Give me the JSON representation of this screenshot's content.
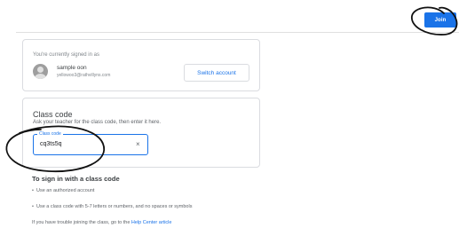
{
  "header": {
    "join_label": "Join"
  },
  "account": {
    "signed_in_text": "You're currently signed in as",
    "name": "sample oon",
    "email": "yellowoo3@rathvillyns.com",
    "switch_label": "Switch account"
  },
  "class_code": {
    "title": "Class code",
    "help": "Ask your teacher for the class code, then enter it here.",
    "field_label": "Class code",
    "value": "cq3ts5q",
    "clear_icon": "×"
  },
  "instructions": {
    "title": "To sign in with a class code",
    "items": [
      "Use an authorized account",
      "Use a class code with 5-7 letters or numbers, and no spaces or symbols"
    ],
    "trouble_text": "If you have trouble joining the class, go to the ",
    "trouble_link": "Help Center article"
  },
  "colors": {
    "accent": "#1a73e8",
    "border": "#dadce0",
    "text": "#3c4043"
  }
}
